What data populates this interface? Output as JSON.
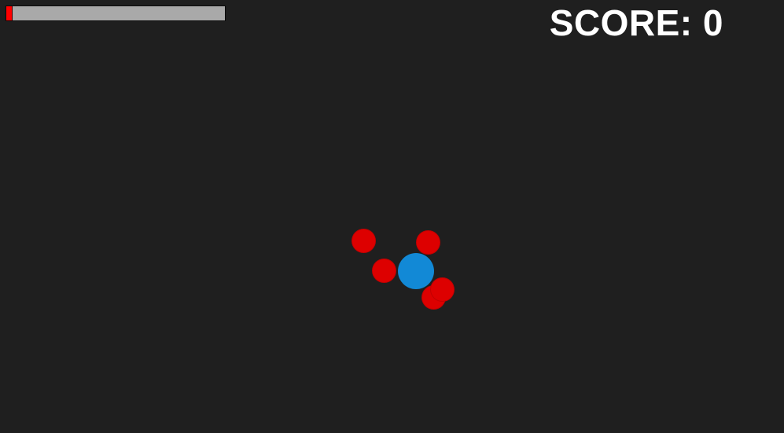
{
  "colors": {
    "background": "#1f1f1f",
    "bar_track": "#a9a9a9",
    "bar_fill": "#ff0000",
    "player": "#1289d6",
    "enemy": "#dd0000",
    "text": "#ffffff"
  },
  "hud": {
    "progress_fraction": 0.03,
    "score_label": "SCORE:",
    "score_value": "0"
  },
  "entities": {
    "player": {
      "shape": "circle"
    },
    "enemies_count": 5
  }
}
